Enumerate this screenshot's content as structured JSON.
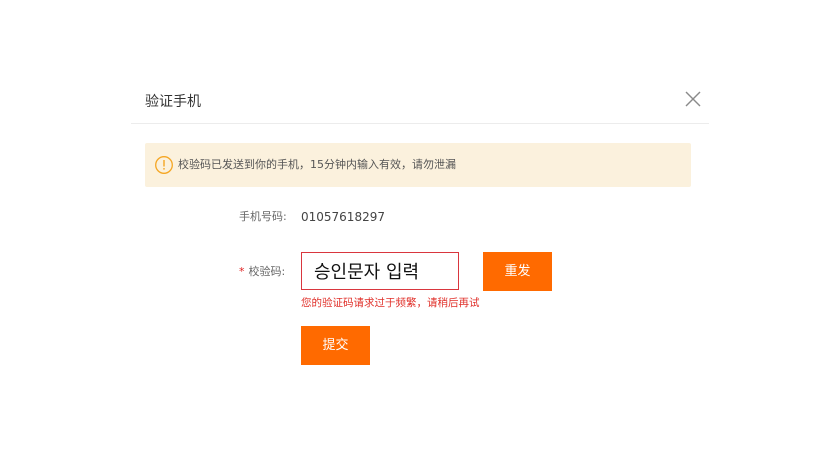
{
  "dialog": {
    "title": "验证手机",
    "close_icon": "close-icon"
  },
  "notice": {
    "icon": "info-circle-icon",
    "text": "校验码已发送到你的手机，15分钟内输入有效，请勿泄漏",
    "background_color": "#fbf1dd",
    "icon_color": "#f5a623"
  },
  "form": {
    "phone_label": "手机号码:",
    "phone_value": "01057618297",
    "code_required_mark": "*",
    "code_label": "校验码:",
    "code_input_value": "승인문자 입력",
    "resend_label": "重发",
    "error_message": "您的验证码请求过于频繁，请稍后再试",
    "submit_label": "提交"
  },
  "colors": {
    "accent": "#ff6a00",
    "error": "#e0302a"
  }
}
